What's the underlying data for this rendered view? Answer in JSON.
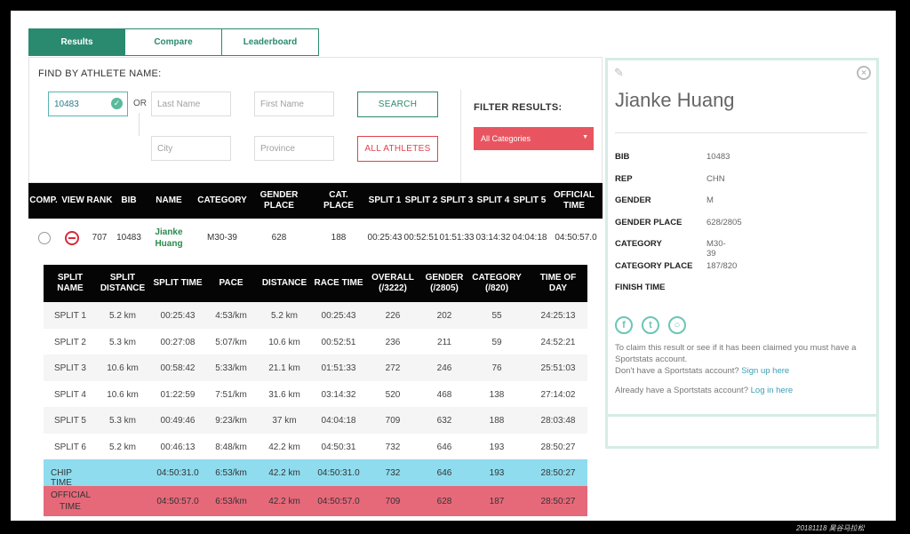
{
  "tabs": [
    {
      "label": "Results",
      "active": true
    },
    {
      "label": "Compare",
      "active": false
    },
    {
      "label": "Leaderboard",
      "active": false
    }
  ],
  "search": {
    "title": "FIND BY ATHLETE NAME:",
    "bib_value": "10483",
    "or_label": "OR",
    "last_name_placeholder": "Last Name",
    "first_name_placeholder": "First Name",
    "city_placeholder": "City",
    "province_placeholder": "Province",
    "search_button": "SEARCH",
    "all_athletes_button": "ALL ATHLETES",
    "filter_title": "FILTER RESULTS:",
    "filter_selected": "All Categories"
  },
  "results": {
    "headers": {
      "comp": "COMP.",
      "view": "VIEW",
      "rank": "RANK",
      "bib": "BIB",
      "name": "NAME",
      "category": "CATEGORY",
      "gender_place": "GENDER PLACE",
      "cat_place": "CAT. PLACE",
      "split1": "SPLIT 1",
      "split2": "SPLIT 2",
      "split3": "SPLIT 3",
      "split4": "SPLIT 4",
      "split5": "SPLIT 5",
      "official_time": "OFFICIAL TIME"
    },
    "row": {
      "rank": "707",
      "bib": "10483",
      "name": "Jianke Huang",
      "category": "M30-39",
      "gender_place": "628",
      "cat_place": "188",
      "split1": "00:25:43",
      "split2": "00:52:51",
      "split3": "01:51:33",
      "split4": "03:14:32",
      "split5": "04:04:18",
      "official_time": "04:50:57.0"
    }
  },
  "splits": {
    "headers": {
      "name": "SPLIT NAME",
      "distance": "SPLIT DISTANCE",
      "time": "SPLIT TIME",
      "pace": "PACE",
      "cum_distance": "DISTANCE",
      "race_time": "RACE TIME",
      "overall": "OVERALL (/3222)",
      "gender": "GENDER (/2805)",
      "category": "CATEGORY (/820)",
      "tod": "TIME OF DAY"
    },
    "rows": [
      {
        "name": "SPLIT 1",
        "distance": "5.2 km",
        "time": "00:25:43",
        "pace": "4:53/km",
        "cum_distance": "5.2 km",
        "race_time": "00:25:43",
        "overall": "226",
        "gender": "202",
        "category": "55",
        "tod": "24:25:13"
      },
      {
        "name": "SPLIT 2",
        "distance": "5.3 km",
        "time": "00:27:08",
        "pace": "5:07/km",
        "cum_distance": "10.6 km",
        "race_time": "00:52:51",
        "overall": "236",
        "gender": "211",
        "category": "59",
        "tod": "24:52:21"
      },
      {
        "name": "SPLIT 3",
        "distance": "10.6 km",
        "time": "00:58:42",
        "pace": "5:33/km",
        "cum_distance": "21.1 km",
        "race_time": "01:51:33",
        "overall": "272",
        "gender": "246",
        "category": "76",
        "tod": "25:51:03"
      },
      {
        "name": "SPLIT 4",
        "distance": "10.6 km",
        "time": "01:22:59",
        "pace": "7:51/km",
        "cum_distance": "31.6 km",
        "race_time": "03:14:32",
        "overall": "520",
        "gender": "468",
        "category": "138",
        "tod": "27:14:02"
      },
      {
        "name": "SPLIT 5",
        "distance": "5.3 km",
        "time": "00:49:46",
        "pace": "9:23/km",
        "cum_distance": "37 km",
        "race_time": "04:04:18",
        "overall": "709",
        "gender": "632",
        "category": "188",
        "tod": "28:03:48"
      },
      {
        "name": "SPLIT 6",
        "distance": "5.2 km",
        "time": "00:46:13",
        "pace": "8:48/km",
        "cum_distance": "42.2 km",
        "race_time": "04:50:31",
        "overall": "732",
        "gender": "646",
        "category": "193",
        "tod": "28:50:27"
      }
    ],
    "chip": {
      "name": "CHIP TIME",
      "time": "04:50:31.0",
      "pace": "6:53/km",
      "cum_distance": "42.2 km",
      "race_time": "04:50:31.0",
      "overall": "732",
      "gender": "646",
      "category": "193",
      "tod": "28:50:27"
    },
    "official": {
      "name": "OFFICIAL TIME",
      "time": "04:50:57.0",
      "pace": "6:53/km",
      "cum_distance": "42.2 km",
      "race_time": "04:50:57.0",
      "overall": "709",
      "gender": "628",
      "category": "187",
      "tod": "28:50:27"
    }
  },
  "profile": {
    "name": "Jianke Huang",
    "fields": [
      {
        "label": "BIB",
        "value": "10483"
      },
      {
        "label": "REP",
        "value": "CHN"
      },
      {
        "label": "GENDER",
        "value": "M"
      },
      {
        "label": "GENDER PLACE",
        "value": "628/2805"
      },
      {
        "label": "CATEGORY",
        "value": "M30-39"
      },
      {
        "label": "CATEGORY PLACE",
        "value": "187/820"
      },
      {
        "label": "FINISH TIME",
        "value": ""
      }
    ],
    "social": [
      "facebook-icon",
      "twitter-icon",
      "search-icon"
    ],
    "claim_text": "To claim this result or see if it has been claimed you must have a Sportstats account.",
    "signup_prefix": "Don't have a Sportstats account?",
    "signup_link": "Sign up here",
    "login_prefix": "Already have a Sportstats account?",
    "login_link": "Log in here"
  },
  "watermark": "20181118  昊谷马拉松"
}
